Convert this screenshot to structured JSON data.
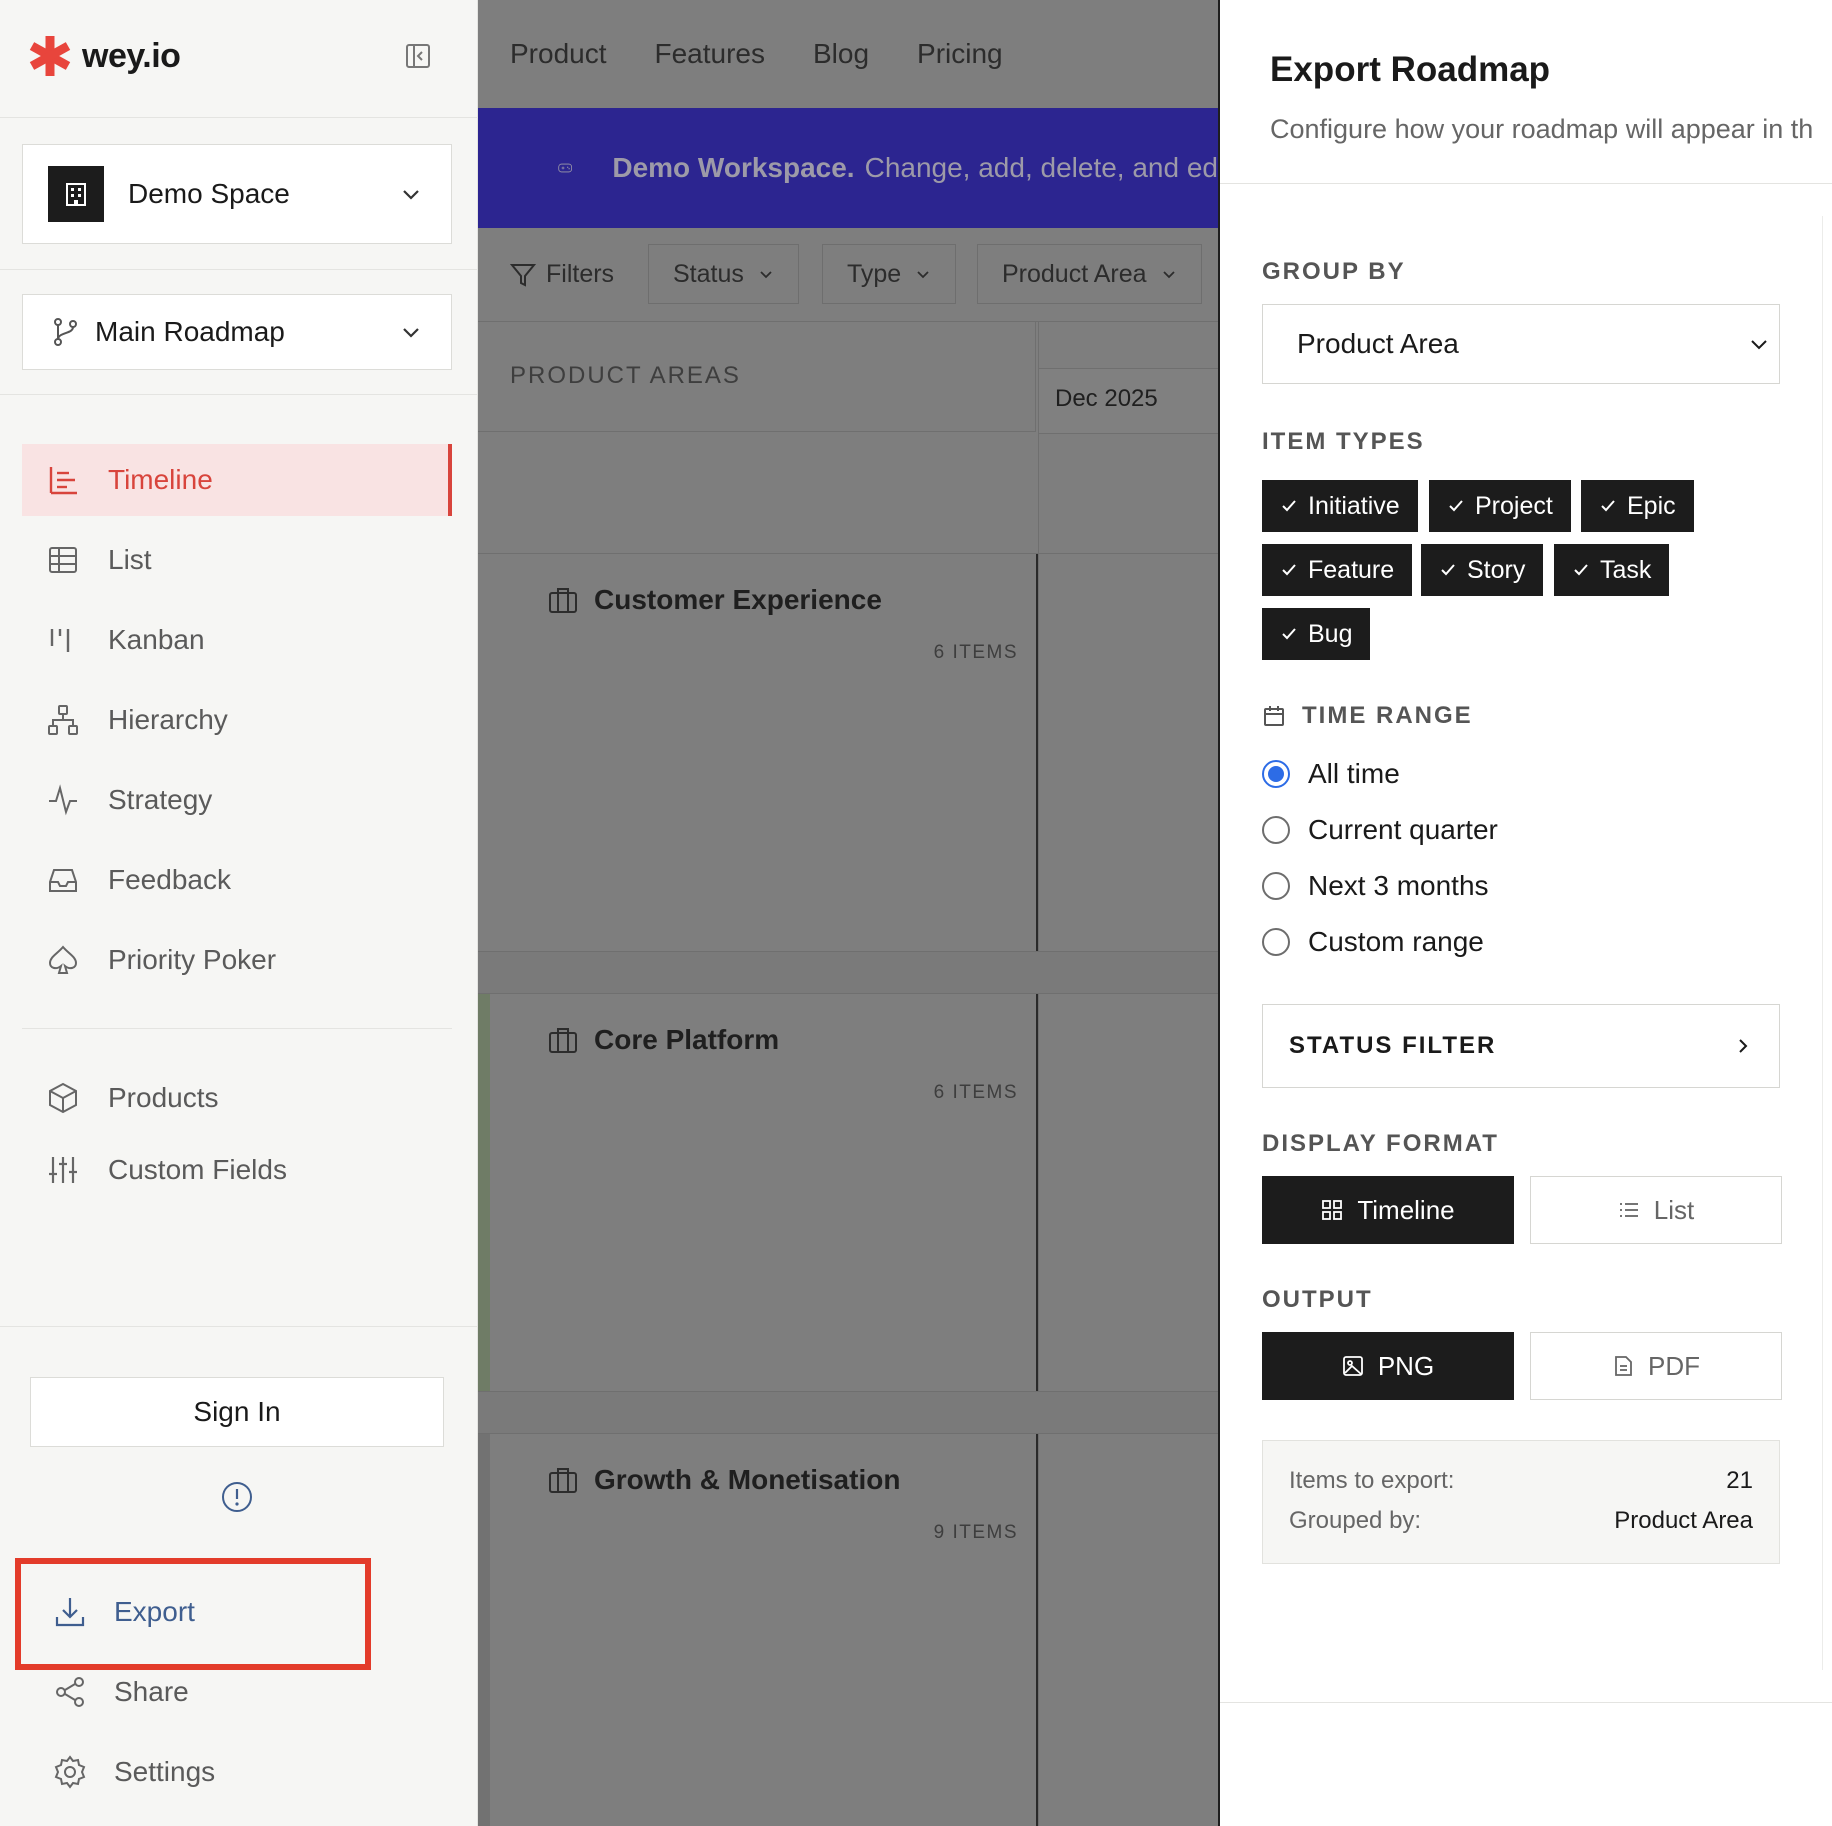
{
  "app": {
    "name": "wey.io",
    "brand_color": "#e8453c"
  },
  "sidebar": {
    "space": {
      "label": "Demo Space",
      "icon": "building-icon"
    },
    "roadmap": {
      "label": "Main Roadmap",
      "icon": "branch-icon"
    },
    "nav": [
      {
        "label": "Timeline",
        "icon": "timeline-icon",
        "active": true
      },
      {
        "label": "List",
        "icon": "table-icon"
      },
      {
        "label": "Kanban",
        "icon": "kanban-icon"
      },
      {
        "label": "Hierarchy",
        "icon": "hierarchy-icon"
      },
      {
        "label": "Strategy",
        "icon": "pulse-icon"
      },
      {
        "label": "Feedback",
        "icon": "inbox-icon"
      },
      {
        "label": "Priority Poker",
        "icon": "spade-icon"
      }
    ],
    "nav2": [
      {
        "label": "Products",
        "icon": "cube-icon"
      },
      {
        "label": "Custom Fields",
        "icon": "sliders-icon"
      }
    ],
    "sign_in": "Sign In",
    "footer": [
      {
        "label": "Export",
        "icon": "download-icon"
      },
      {
        "label": "Share",
        "icon": "share-icon"
      },
      {
        "label": "Settings",
        "icon": "gear-icon"
      }
    ]
  },
  "main": {
    "topnav": [
      "Product",
      "Features",
      "Blog",
      "Pricing"
    ],
    "banner": {
      "bold": "Demo Workspace.",
      "text": "Change, add, delete, and ed"
    },
    "filters": {
      "label": "Filters",
      "buttons": [
        "Status",
        "Type",
        "Product Area"
      ]
    },
    "columns": {
      "areas_header": "PRODUCT AREAS",
      "date": "Dec 2025"
    },
    "groups": [
      {
        "title": "Customer Experience",
        "count": "6 ITEMS"
      },
      {
        "title": "Core Platform",
        "count": "6 ITEMS"
      },
      {
        "title": "Growth & Monetisation",
        "count": "9 ITEMS"
      }
    ]
  },
  "export_panel": {
    "title": "Export Roadmap",
    "subtitle": "Configure how your roadmap will appear in th",
    "group_by": {
      "label": "GROUP BY",
      "value": "Product Area"
    },
    "item_types": {
      "label": "ITEM TYPES",
      "items": [
        "Initiative",
        "Project",
        "Epic",
        "Feature",
        "Story",
        "Task",
        "Bug"
      ]
    },
    "time_range": {
      "label": "TIME RANGE",
      "options": [
        "All time",
        "Current quarter",
        "Next 3 months",
        "Custom range"
      ],
      "selected": "All time"
    },
    "status_filter": "STATUS FILTER",
    "display_format": {
      "label": "DISPLAY FORMAT",
      "options": [
        "Timeline",
        "List"
      ],
      "selected": "Timeline"
    },
    "output": {
      "label": "OUTPUT",
      "options": [
        "PNG",
        "PDF"
      ],
      "selected": "PNG"
    },
    "summary": {
      "items_label": "Items to export:",
      "items_value": "21",
      "grouped_label": "Grouped by:",
      "grouped_value": "Product Area"
    }
  }
}
